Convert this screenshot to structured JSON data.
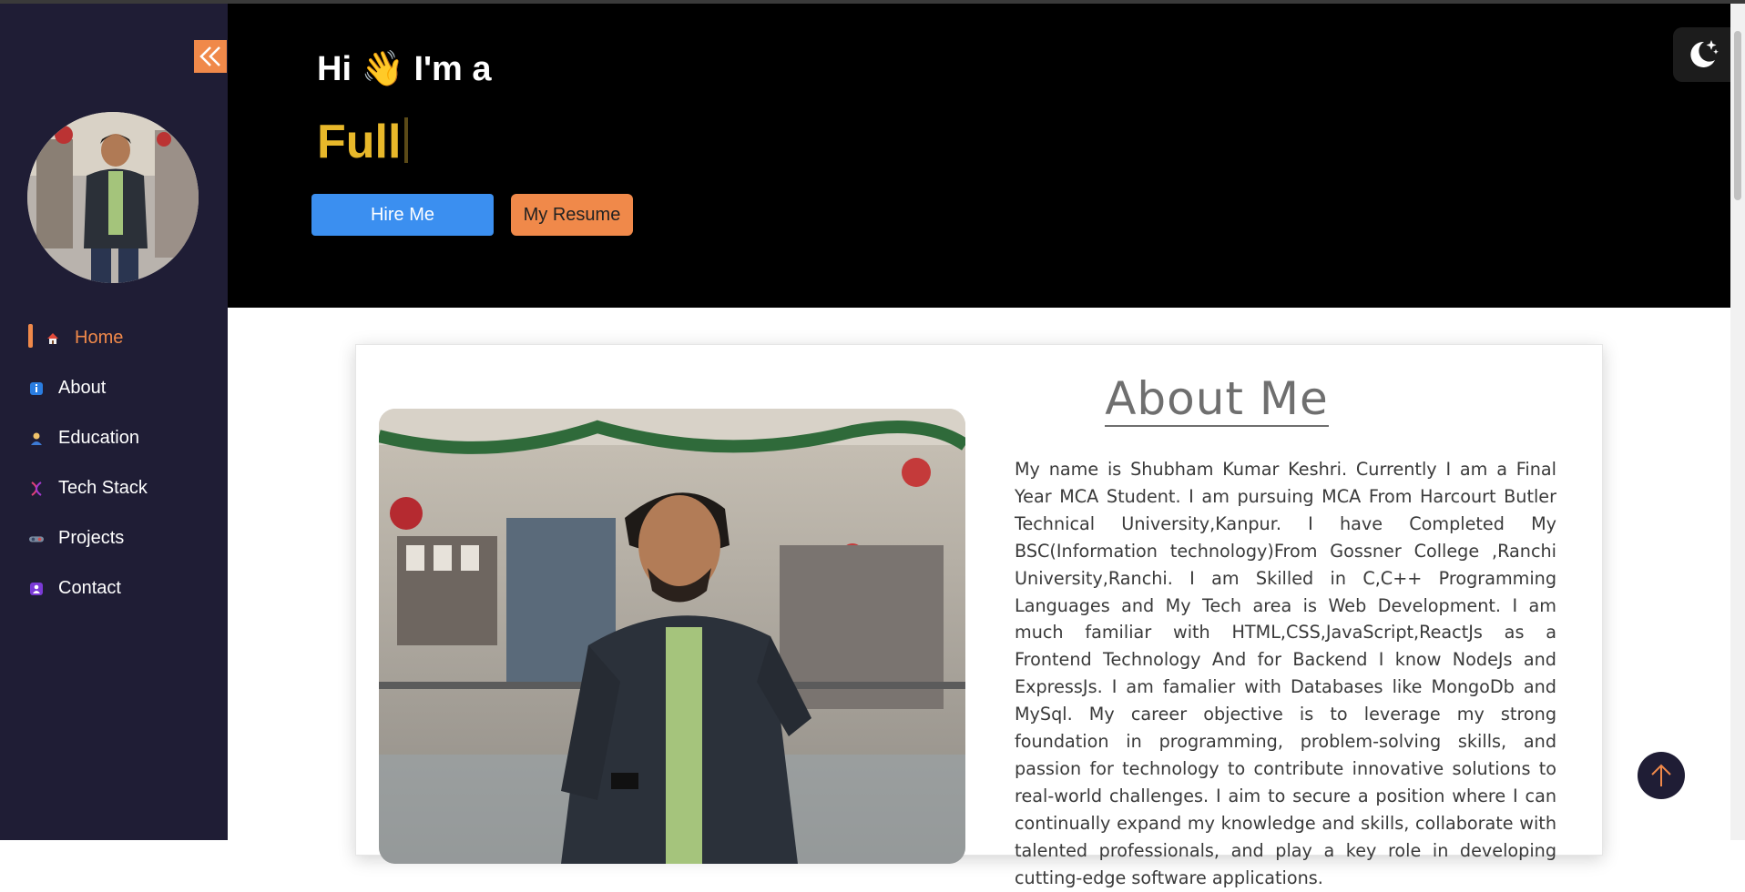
{
  "hero": {
    "greeting_prefix": "Hi",
    "greeting_emoji": "👋",
    "greeting_suffix": "I'm a",
    "typed_text": "Full",
    "hire_label": "Hire Me",
    "resume_label": "My Resume"
  },
  "sidebar": {
    "items": [
      {
        "label": "Home",
        "icon": "house-icon"
      },
      {
        "label": "About",
        "icon": "info-icon"
      },
      {
        "label": "Education",
        "icon": "student-icon"
      },
      {
        "label": "Tech Stack",
        "icon": "dna-icon"
      },
      {
        "label": "Projects",
        "icon": "projects-icon"
      },
      {
        "label": "Contact",
        "icon": "contact-card-icon"
      }
    ],
    "active": "Home"
  },
  "about": {
    "title": "About Me",
    "text": "My name is Shubham Kumar Keshri. Currently I am a Final Year MCA Student. I am pursuing MCA From Harcourt Butler Technical University,Kanpur. I have Completed My BSC(Information technology)From Gossner College ,Ranchi University,Ranchi. I am Skilled in C,C++ Programming Languages and My Tech area is Web Development. I am much familiar with HTML,CSS,JavaScript,ReactJs as a Frontend Technology And for Backend I know NodeJs and ExpressJs. I am famalier with Databases like MongoDb and MySql. My career objective is to leverage my strong foundation in programming, problem-solving skills, and passion for technology to contribute innovative solutions to real-world challenges. I aim to secure a position where I can continually expand my knowledge and skills, collaborate with talented professionals, and play a key role in developing cutting-edge software applications."
  },
  "colors": {
    "accent": "#f0894a",
    "sidebar_bg": "#1f1d35",
    "hire_button": "#3b8ff0",
    "typed_text": "#e8b82a"
  }
}
